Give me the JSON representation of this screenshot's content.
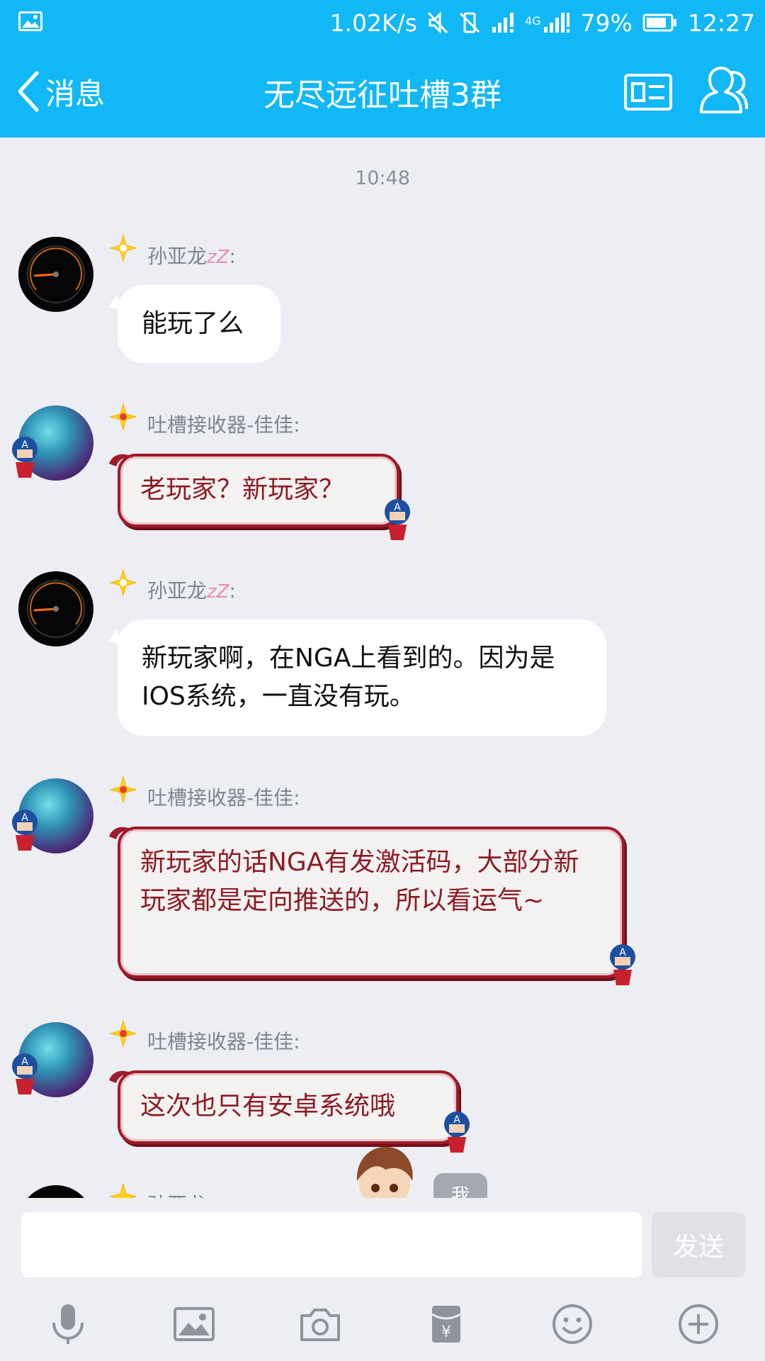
{
  "status_bar": {
    "net_speed": "1.02K/s",
    "network_type": "4G",
    "battery": "79%",
    "time": "12:27"
  },
  "nav": {
    "back_label": "消息",
    "title": "无尽远征吐槽3群"
  },
  "chat": {
    "timestamp": "10:48",
    "messages": [
      {
        "sender": "孙亚龙",
        "sender_suffix": "zZ",
        "colon": ":",
        "text": "能玩了么"
      },
      {
        "sender": "吐槽接收器-佳佳:",
        "text": "老玩家？新玩家？"
      },
      {
        "sender": "孙亚龙",
        "sender_suffix": "zZ",
        "colon": ":",
        "text": "新玩家啊，在NGA上看到的。因为是IOS系统，一直没有玩。"
      },
      {
        "sender": "吐槽接收器-佳佳:",
        "text": "新玩家的话NGA有发激活码，大部分新玩家都是定向推送的，所以看运气~"
      },
      {
        "sender": "吐槽接收器-佳佳:",
        "text": "这次也只有安卓系统哦"
      },
      {
        "sender": "孙亚龙"
      }
    ]
  },
  "me_badge": "我",
  "input": {
    "placeholder": "",
    "send_label": "发送"
  },
  "colors": {
    "accent": "#12b7f5",
    "background": "#eceef3",
    "bubble_red_text": "#8b1c24"
  },
  "toolbar_icons": [
    "microphone-icon",
    "image-icon",
    "camera-icon",
    "red-packet-icon",
    "emoji-icon",
    "plus-icon"
  ]
}
